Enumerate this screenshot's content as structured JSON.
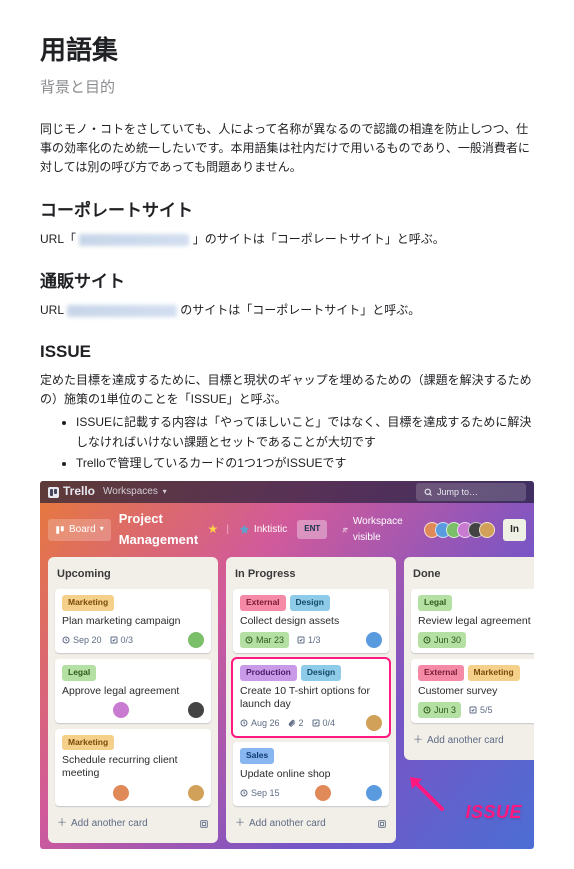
{
  "doc": {
    "title": "用語集",
    "subtitle": "背景と目的",
    "intro": "同じモノ・コトをさしていても、人によって名称が異なるので認識の相違を防止しつつ、仕事の効率化のため統一したいです。本用語集は社内だけで用いるものであり、一般消費者に対しては別の呼び方であっても問題ありません。",
    "sections": {
      "corp": {
        "heading": "コーポレートサイト",
        "line_pre": "URL「",
        "line_post": "」のサイトは「コーポレートサイト」と呼ぶ。"
      },
      "ec": {
        "heading": "通販サイト",
        "line_pre": "URL ",
        "line_post": " のサイトは「コーポレートサイト」と呼ぶ。"
      },
      "issue": {
        "heading": "ISSUE",
        "desc": "定めた目標を達成するために、目標と現状のギャップを埋めるための（課題を解決するための）施策の1単位のことを「ISSUE」と呼ぶ。",
        "bullets": [
          "ISSUEに記載する内容は「やってほしいこと」ではなく、目標を達成するために解決しなければいけない課題とセットであることが大切です",
          "Trelloで管理しているカードの1つ1つがISSUEです"
        ]
      }
    }
  },
  "trello": {
    "brand": "Trello",
    "top": {
      "workspaces": "Workspaces",
      "search": "Jump to…"
    },
    "board": {
      "viewchip": "Board",
      "title": "Project Management",
      "org": "Inktistic",
      "tier": "ENT",
      "visibility": "Workspace visible",
      "invite": "In"
    },
    "columns": [
      {
        "title": "Upcoming",
        "cards": [
          {
            "labels": [
              {
                "cls": "l-marketing",
                "t": "Marketing"
              }
            ],
            "title": "Plan marketing campaign",
            "date": "Sep 20",
            "attach": "",
            "checklist": "0/3",
            "avatars": [
              "a3"
            ]
          },
          {
            "labels": [
              {
                "cls": "l-legal",
                "t": "Legal"
              }
            ],
            "title": "Approve legal agreement",
            "date": "",
            "attach": "",
            "checklist": "",
            "avatars": [
              "a4",
              "a5"
            ]
          },
          {
            "labels": [
              {
                "cls": "l-marketing",
                "t": "Marketing"
              }
            ],
            "title": "Schedule recurring client meeting",
            "date": "",
            "attach": "",
            "checklist": "",
            "avatars": [
              "a1",
              "a6"
            ]
          }
        ],
        "add": "Add another card"
      },
      {
        "title": "In Progress",
        "cards": [
          {
            "labels": [
              {
                "cls": "l-external",
                "t": "External"
              },
              {
                "cls": "l-design",
                "t": "Design"
              }
            ],
            "title": "Collect design assets",
            "date": "Mar 23",
            "done": true,
            "checklist": "1/3",
            "avatars": [
              "a2"
            ]
          },
          {
            "hl": true,
            "labels": [
              {
                "cls": "l-production",
                "t": "Production"
              },
              {
                "cls": "l-design",
                "t": "Design"
              }
            ],
            "title": "Create 10 T-shirt options for launch day",
            "date": "Aug 26",
            "attach": "2",
            "checklist": "0/4",
            "avatars": [
              "a6"
            ]
          },
          {
            "labels": [
              {
                "cls": "l-sales",
                "t": "Sales"
              }
            ],
            "title": "Update online shop",
            "date": "Sep 15",
            "avatars": [
              "a1",
              "a2"
            ]
          }
        ],
        "add": "Add another card"
      },
      {
        "title": "Done",
        "cards": [
          {
            "labels": [
              {
                "cls": "l-legal",
                "t": "Legal"
              }
            ],
            "title": "Review legal agreement",
            "date": "Jun 30",
            "done": true,
            "avatars": [
              "a5"
            ]
          },
          {
            "labels": [
              {
                "cls": "l-external",
                "t": "External"
              },
              {
                "cls": "l-marketing",
                "t": "Marketing"
              }
            ],
            "title": "Customer survey",
            "date": "Jun 3",
            "done": true,
            "checklist": "5/5",
            "avatars": [
              "a4"
            ]
          }
        ],
        "add": "Add another card"
      }
    ],
    "callout": "ISSUE"
  }
}
